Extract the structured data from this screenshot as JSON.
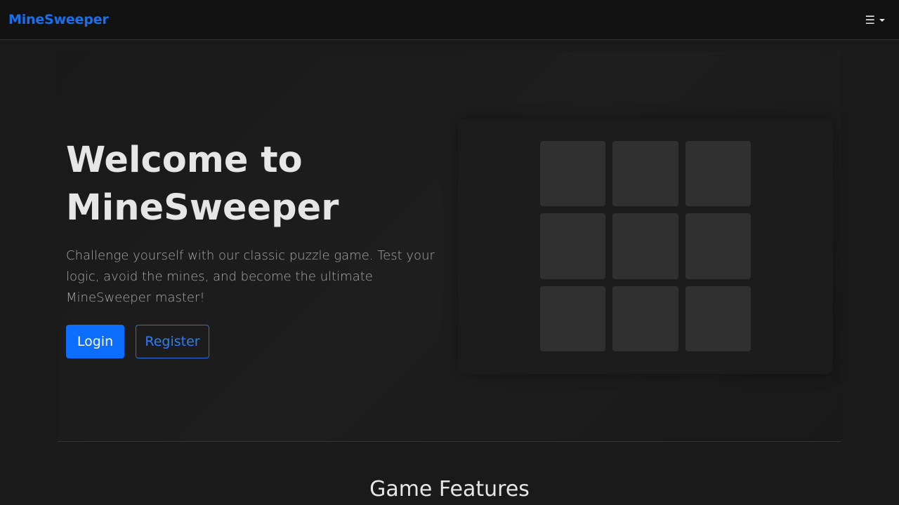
{
  "navbar": {
    "brand": "MineSweeper",
    "menu_icon": "hamburger-icon",
    "menu_glyph": "☰"
  },
  "hero": {
    "title": "Welcome to MineSweeper",
    "description": "Challenge yourself with our classic puzzle game. Test your logic, avoid the mines, and become the ultimate MineSweeper master!",
    "login_label": "Login",
    "register_label": "Register"
  },
  "board": {
    "rows": 3,
    "columns": 3
  },
  "features": {
    "title": "Game Features"
  },
  "colors": {
    "brand": "#1a6ff0",
    "primary_button": "#0d6efd",
    "background": "#1a1a1a",
    "navbar": "#121212",
    "cell": "#303030"
  }
}
